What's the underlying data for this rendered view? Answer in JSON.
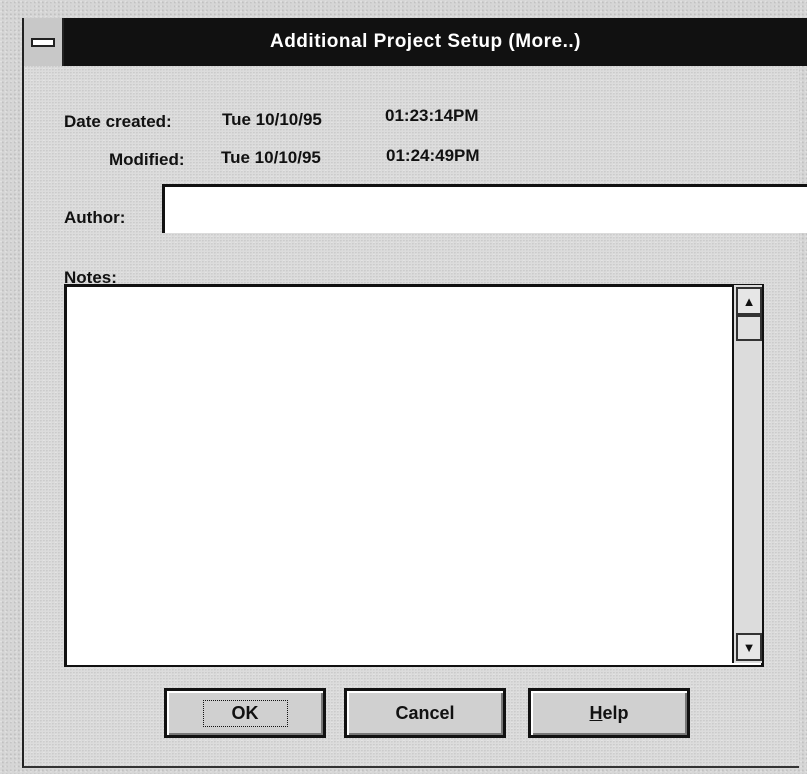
{
  "window": {
    "title": "Additional Project Setup (More..)"
  },
  "info": {
    "date_created_label": "Date created:",
    "date_created_date": "Tue 10/10/95",
    "date_created_time": "01:23:14PM",
    "modified_label": "Modified:",
    "modified_date": "Tue 10/10/95",
    "modified_time": "01:24:49PM"
  },
  "form": {
    "author_label": "Author:",
    "author_value": "",
    "notes_label": "Notes:",
    "notes_value": ""
  },
  "buttons": {
    "ok_label": "OK",
    "cancel_label": "Cancel",
    "help_mnemonic": "H",
    "help_rest": "elp"
  },
  "icons": {
    "system_menu": "system-menu-icon",
    "scroll_up": "arrow-up-icon",
    "scroll_down": "arrow-down-icon"
  }
}
